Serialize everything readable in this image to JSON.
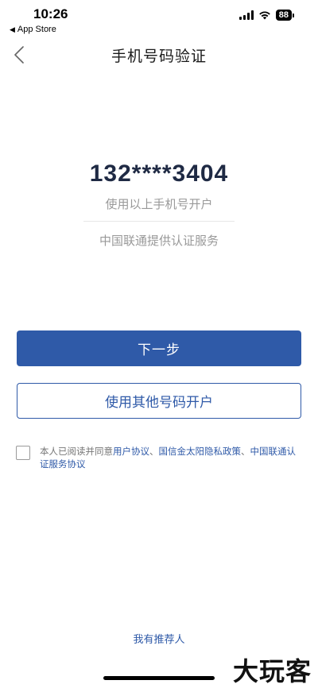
{
  "status_bar": {
    "time": "10:26",
    "back_app": "App Store",
    "battery": "88"
  },
  "nav": {
    "title": "手机号码验证"
  },
  "verification": {
    "phone_number": "132****3404",
    "subtitle": "使用以上手机号开户",
    "provider": "中国联通提供认证服务"
  },
  "buttons": {
    "next": "下一步",
    "other_number": "使用其他号码开户"
  },
  "agreement": {
    "prefix": "本人已阅读并同意",
    "link1": "用户协议",
    "sep1": "、",
    "link2": "国信金太阳隐私政策",
    "sep2": "、",
    "link3": "中国联通认证服务协议"
  },
  "footer": {
    "referrer": "我有推荐人",
    "watermark": "大玩客"
  },
  "colors": {
    "accent": "#2f5aa8",
    "muted_text": "#999999",
    "phone_text": "#1f2a44"
  }
}
